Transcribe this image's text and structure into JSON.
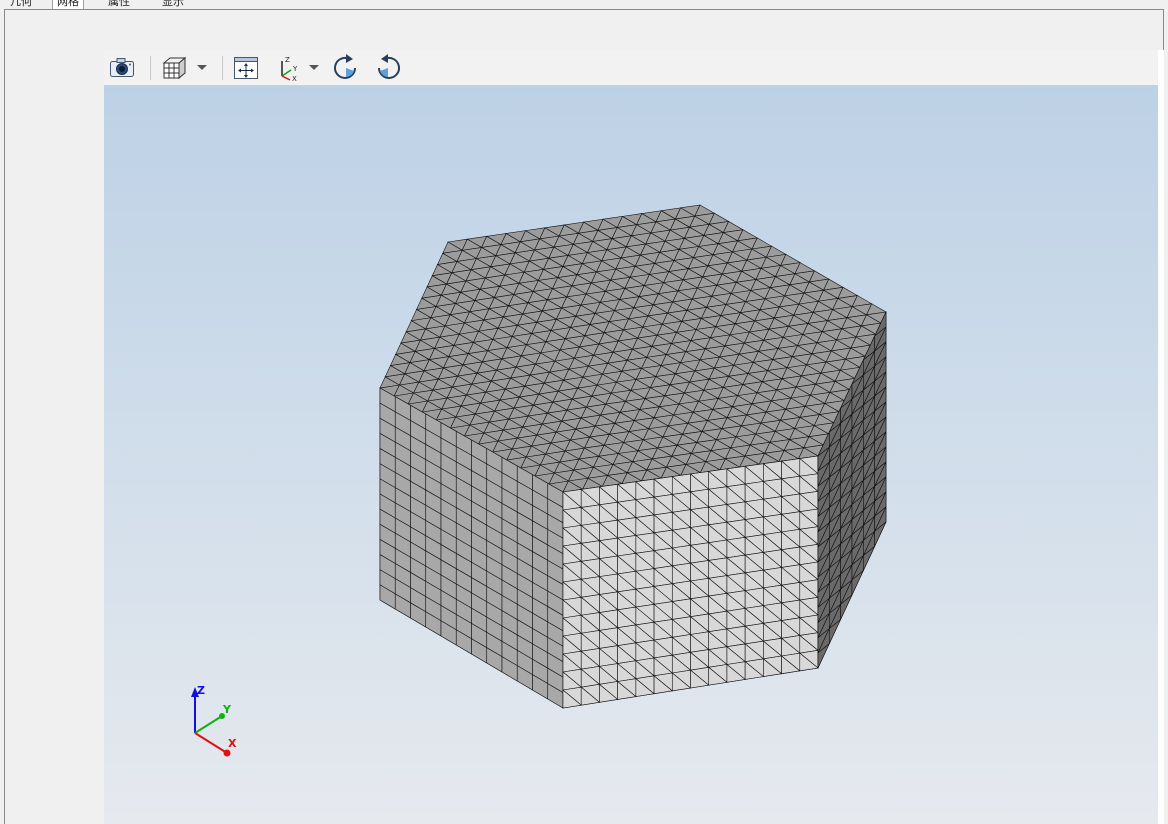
{
  "tabs": [
    {
      "label": "几何"
    },
    {
      "label": "网格"
    },
    {
      "label": "属性"
    },
    {
      "label": "显示"
    }
  ],
  "toolbar": {
    "buttons": [
      {
        "icon": "camera-icon"
      },
      {
        "icon": "cube-view-icon"
      },
      {
        "icon": "fit-all-icon"
      },
      {
        "icon": "axes-orientation-icon"
      },
      {
        "icon": "rotate-cw-icon"
      },
      {
        "icon": "rotate-ccw-icon"
      }
    ]
  },
  "viewport": {
    "triad": {
      "x_label": "X",
      "y_label": "Y",
      "z_label": "Z"
    },
    "colors": {
      "bg_top": "#bdd1e6",
      "bg_bottom": "#e6e9ee",
      "top_face": "#9c9c9c",
      "left_face": "#a8a8a8",
      "front_face": "#d8d8d8",
      "right_face": "#6a6a6a",
      "mesh_line": "#111111",
      "axis_x": "#e01010",
      "axis_y": "#10b010",
      "axis_z": "#1010e0"
    }
  }
}
